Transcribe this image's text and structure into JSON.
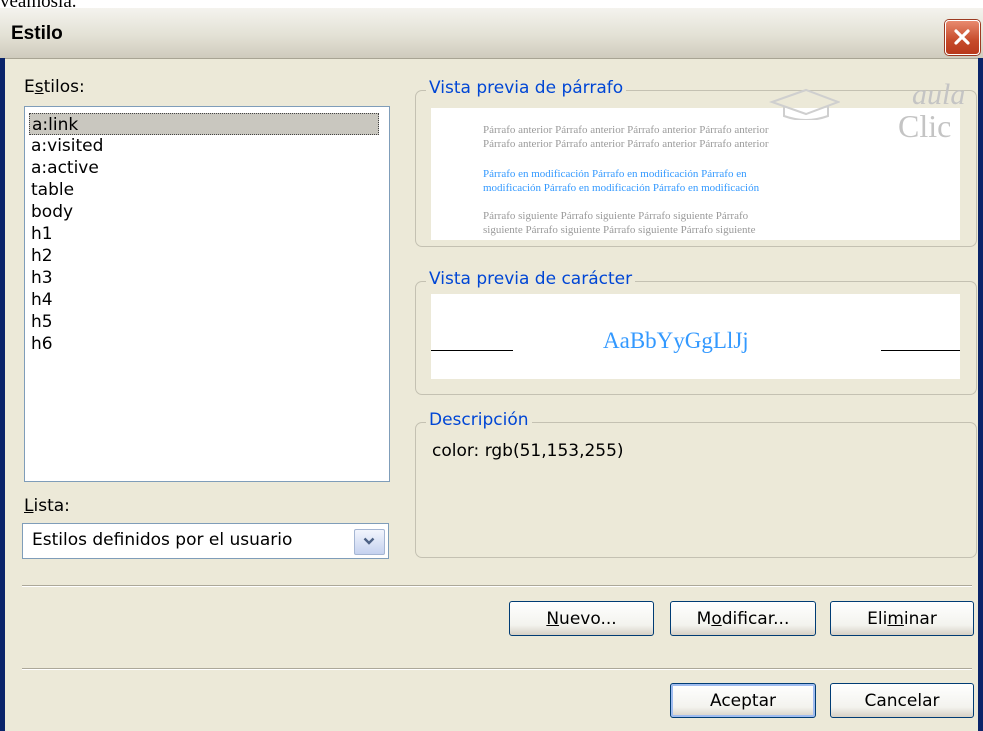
{
  "top_text": "veamosla.",
  "dialog": {
    "title": "Estilo",
    "close_glyph": "✕"
  },
  "styles_label": {
    "pre": "E",
    "accel": "s",
    "post": "tilos:"
  },
  "styles_list": [
    {
      "label": "a:link",
      "selected": true
    },
    {
      "label": "a:visited"
    },
    {
      "label": "a:active"
    },
    {
      "label": "table"
    },
    {
      "label": "body"
    },
    {
      "label": "h1"
    },
    {
      "label": "h2"
    },
    {
      "label": "h3"
    },
    {
      "label": "h4"
    },
    {
      "label": "h5"
    },
    {
      "label": "h6"
    }
  ],
  "list_label": {
    "accel": "L",
    "post": "ista:"
  },
  "list_select": {
    "value": "Estilos definidos por el usuario"
  },
  "paragraph_preview": {
    "title": "Vista previa de párrafo",
    "previous_lines": [
      "Párrafo anterior Párrafo anterior Párrafo anterior Párrafo anterior",
      "Párrafo anterior Párrafo anterior Párrafo anterior Párrafo anterior"
    ],
    "current_lines": [
      "Párrafo en modificación Párrafo en modificación Párrafo en",
      "modificación Párrafo en modificación Párrafo en modificación"
    ],
    "next_lines": [
      "Párrafo siguiente Párrafo siguiente Párrafo siguiente Párrafo",
      "siguiente Párrafo siguiente Párrafo siguiente Párrafo siguiente"
    ]
  },
  "character_preview": {
    "title": "Vista previa de carácter",
    "sample": "AaBbYyGgLlJj"
  },
  "description": {
    "title": "Descripción",
    "text": "color: rgb(51,153,255)"
  },
  "watermark": {
    "top": "aula",
    "bottom": "Clic"
  },
  "buttons": {
    "new": {
      "accel": "N",
      "post": "uevo..."
    },
    "modify": {
      "pre": "M",
      "accel": "o",
      "post": "dificar..."
    },
    "delete": {
      "pre": "Eli",
      "accel": "m",
      "post": "inar"
    },
    "accept": "Aceptar",
    "cancel": "Cancelar"
  },
  "colors": {
    "title_blue": "#0046d5",
    "link_color": "#3399ff",
    "dialog_bg": "#ece9d8",
    "close_red": "#c64a2a"
  }
}
